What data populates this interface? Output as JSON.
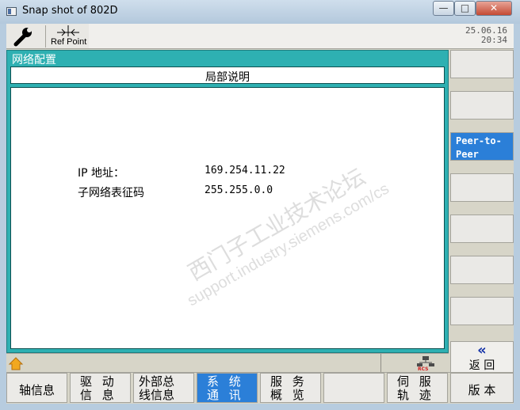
{
  "window": {
    "title": "Snap shot of 802D",
    "minimize": "—",
    "maximize": "□",
    "close": "✕"
  },
  "header": {
    "ref_label": "Ref Point",
    "date": "25.06.16",
    "time": "20:34"
  },
  "panel": {
    "title": "网络配置",
    "subheader": "局部说明",
    "ip_label": "IP 地址：",
    "ip_value": "169.254.11.22",
    "mask_label": "子网络表征码",
    "mask_value": "255.255.0.0"
  },
  "watermark": {
    "line1": "西门子工业技术论坛",
    "line2": "support.industry.siemens.com/cs"
  },
  "vertical_softkeys": [
    {
      "label": ""
    },
    {
      "label": ""
    },
    {
      "label": "Peer-to-\nPeer",
      "active": true
    },
    {
      "label": ""
    },
    {
      "label": ""
    },
    {
      "label": ""
    },
    {
      "label": ""
    }
  ],
  "vk_peer_line1": "Peer-to-",
  "vk_peer_line2": "Peer",
  "back": {
    "icon": "«",
    "label": "返 回"
  },
  "horizontal_softkeys": {
    "k1": "轴信息",
    "k2_l1": "驱 动",
    "k2_l2": "信 息",
    "k3_l1": "外部总",
    "k3_l2": "线信息",
    "k4_l1": "系 统",
    "k4_l2": "通 讯",
    "k5_l1": "服 务",
    "k5_l2": "概 览",
    "k7_l1": "伺 服",
    "k7_l2": "轨 迹",
    "k8": "版 本"
  },
  "colors": {
    "accent_teal": "#2eb0b2",
    "active_blue": "#2b7fd8"
  }
}
